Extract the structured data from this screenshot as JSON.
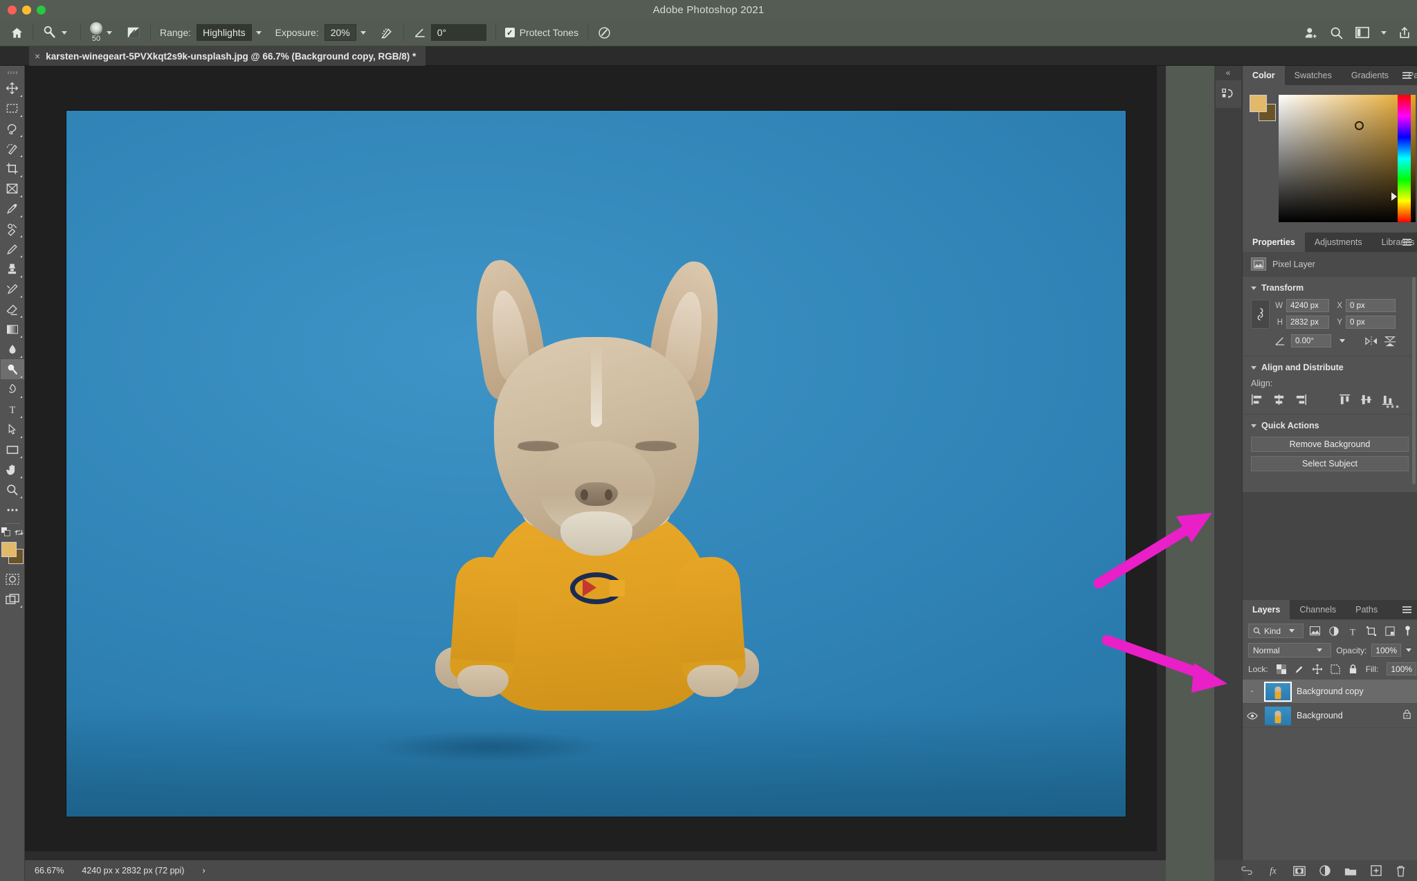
{
  "window": {
    "title": "Adobe Photoshop 2021",
    "traffic_lights": [
      "close",
      "minimize",
      "zoom"
    ]
  },
  "options_bar": {
    "home_icon": "home-icon",
    "tool_preset_icon": "dodge-tool-icon",
    "brush_size": "50",
    "brush_preset_icon": "brush-softness-icon",
    "toggle_brush_panel_icon": "brush-panel-toggle-icon",
    "range_label": "Range:",
    "range_value": "Highlights",
    "exposure_label": "Exposure:",
    "exposure_value": "20%",
    "airbrush_icon": "airbrush-pressure-icon",
    "angle_icon": "angle-icon",
    "angle_value": "0°",
    "protect_tones_label": "Protect Tones",
    "protect_tones_checked": true,
    "pressure_icon": "pressure-for-size-icon",
    "right_icons": [
      "add-user-icon",
      "search-icon",
      "workspace-icon",
      "chevron-down-icon",
      "share-icon"
    ]
  },
  "document_tab": {
    "close_glyph": "×",
    "title": "karsten-winegeart-5PVXkqt2s9k-unsplash.jpg @ 66.7% (Background copy, RGB/8) *"
  },
  "toolbar": {
    "tools": [
      {
        "name": "move-tool",
        "glyph": "move",
        "selected": false
      },
      {
        "name": "rectangular-marquee-tool",
        "glyph": "marquee",
        "selected": false
      },
      {
        "name": "lasso-tool",
        "glyph": "lasso",
        "selected": false
      },
      {
        "name": "object-selection-tool",
        "glyph": "quick-select",
        "selected": false
      },
      {
        "name": "crop-tool",
        "glyph": "crop",
        "selected": false
      },
      {
        "name": "frame-tool",
        "glyph": "frame",
        "selected": false
      },
      {
        "name": "eyedropper-tool",
        "glyph": "eyedropper",
        "selected": false
      },
      {
        "name": "spot-healing-brush-tool",
        "glyph": "healing",
        "selected": false
      },
      {
        "name": "brush-tool",
        "glyph": "brush",
        "selected": false
      },
      {
        "name": "clone-stamp-tool",
        "glyph": "stamp",
        "selected": false
      },
      {
        "name": "history-brush-tool",
        "glyph": "history-brush",
        "selected": false
      },
      {
        "name": "eraser-tool",
        "glyph": "eraser",
        "selected": false
      },
      {
        "name": "gradient-tool",
        "glyph": "gradient",
        "selected": false
      },
      {
        "name": "blur-tool",
        "glyph": "blur",
        "selected": false
      },
      {
        "name": "dodge-tool",
        "glyph": "dodge",
        "selected": true
      },
      {
        "name": "pen-tool",
        "glyph": "pen",
        "selected": false
      },
      {
        "name": "type-tool",
        "glyph": "type",
        "selected": false
      },
      {
        "name": "path-selection-tool",
        "glyph": "path-select",
        "selected": false
      },
      {
        "name": "rectangle-tool",
        "glyph": "rectangle",
        "selected": false
      },
      {
        "name": "hand-tool",
        "glyph": "hand",
        "selected": false
      },
      {
        "name": "zoom-tool",
        "glyph": "zoom",
        "selected": false
      },
      {
        "name": "edit-toolbar-tool",
        "glyph": "ellipsis",
        "selected": false
      }
    ],
    "foreground_color": "#e2b86a",
    "background_color": "#6b5328",
    "quick_mask_icon": "quick-mask-icon",
    "screen-mode_icon": "screen-mode-icon"
  },
  "canvas": {
    "zoom_display": "66.7%",
    "image_alt": "French bulldog with closed eyes wearing a yellow Champion sweatshirt on a blue studio background",
    "logo_text": "Champion C"
  },
  "dock": {
    "collapse_glyph": "«",
    "history_icon": "history-panel-icon"
  },
  "color_panel": {
    "tabs": [
      {
        "label": "Color",
        "active": true
      },
      {
        "label": "Swatches",
        "active": false
      },
      {
        "label": "Gradients",
        "active": false
      },
      {
        "label": "Patterns",
        "active": false
      }
    ],
    "menu_icon": "panel-menu-icon",
    "foreground": "#e2b86a",
    "background": "#6b5328"
  },
  "properties_panel": {
    "tabs": [
      {
        "label": "Properties",
        "active": true
      },
      {
        "label": "Adjustments",
        "active": false
      },
      {
        "label": "Libraries",
        "active": false
      }
    ],
    "menu_icon": "panel-menu-icon",
    "layer_kind": "Pixel Layer",
    "transform": {
      "title": "Transform",
      "link_icon": "link-aspect-ratio-icon",
      "w_key": "W",
      "w_value": "4240 px",
      "h_key": "H",
      "h_value": "2832 px",
      "x_key": "X",
      "x_value": "0 px",
      "y_key": "Y",
      "y_value": "0 px",
      "angle_value": "0.00°",
      "flip_horizontal_icon": "flip-horizontal-icon",
      "flip_vertical_icon": "flip-vertical-icon"
    },
    "align": {
      "title": "Align and Distribute",
      "label": "Align:",
      "icons": [
        "align-left-edges-icon",
        "align-horizontal-centers-icon",
        "align-right-edges-icon",
        "align-top-edges-icon",
        "align-vertical-centers-icon",
        "align-bottom-edges-icon"
      ],
      "more_glyph": "•••"
    },
    "quick_actions": {
      "title": "Quick Actions",
      "buttons": [
        "Remove Background",
        "Select Subject"
      ]
    }
  },
  "layers_panel": {
    "tabs": [
      {
        "label": "Layers",
        "active": true
      },
      {
        "label": "Channels",
        "active": false
      },
      {
        "label": "Paths",
        "active": false
      }
    ],
    "menu_icon": "panel-menu-icon",
    "filter": {
      "search_icon": "search-icon",
      "kind_label": "Kind",
      "filter_icons": [
        "filter-pixel-icon",
        "filter-adjustment-icon",
        "filter-type-icon",
        "filter-shape-icon",
        "filter-smart-object-icon",
        "filter-toggle-icon"
      ]
    },
    "blend_mode": "Normal",
    "opacity_label": "Opacity:",
    "opacity_value": "100%",
    "lock_label": "Lock:",
    "lock_icons": [
      "lock-transparent-pixels-icon",
      "lock-image-pixels-icon",
      "lock-position-icon",
      "lock-artboard-nesting-icon",
      "lock-all-icon"
    ],
    "fill_label": "Fill:",
    "fill_value": "100%",
    "layers": [
      {
        "name": "Background copy",
        "visible": false,
        "selected": true,
        "locked": false
      },
      {
        "name": "Background",
        "visible": true,
        "selected": false,
        "locked": true
      }
    ],
    "bottom_icons": [
      "link-layers-icon",
      "layer-style-fx-icon",
      "add-layer-mask-icon",
      "new-adjustment-layer-icon",
      "new-group-icon",
      "new-layer-icon",
      "delete-layer-icon"
    ]
  },
  "status_bar": {
    "zoom": "66.67%",
    "doc_size": "4240 px x 2832 px (72 ppi)",
    "expand_glyph": "›"
  },
  "annotations": {
    "color": "#e91fc8",
    "arrows": [
      {
        "name": "arrow-to-remove-background",
        "target": "Remove Background"
      },
      {
        "name": "arrow-to-background-copy-layer",
        "target": "Background copy"
      }
    ]
  }
}
